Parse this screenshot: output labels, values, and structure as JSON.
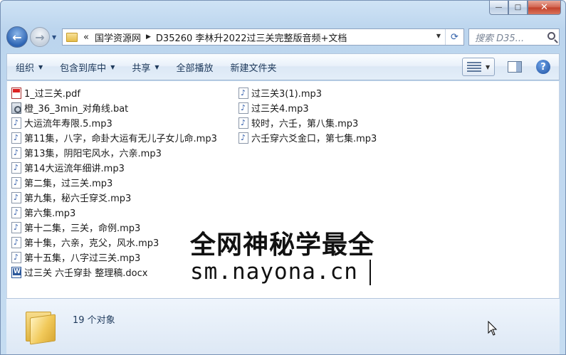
{
  "window": {
    "caption": {
      "minimize": "—",
      "maximize": "□",
      "close": "✕"
    }
  },
  "nav": {
    "back": "←",
    "forward": "→"
  },
  "address": {
    "overflow": "«",
    "parts": [
      "国学资源网",
      "D35260 李林升2022过三关完整版音频+文档"
    ],
    "refresh": "⟳"
  },
  "search": {
    "placeholder": "搜索 D35..."
  },
  "toolbar": {
    "organize": "组织",
    "include_in_library": "包含到库中",
    "share": "共享",
    "play_all": "全部播放",
    "new_folder": "新建文件夹",
    "help": "?"
  },
  "files": {
    "col1": [
      {
        "name": "1_过三关.pdf",
        "type": "pdf"
      },
      {
        "name": "橙_36_3min_对角线.bat",
        "type": "bat"
      },
      {
        "name": "大运流年寿限.5.mp3",
        "type": "mp3"
      },
      {
        "name": "第11集，八字，命卦大运有无儿子女儿命.mp3",
        "type": "mp3"
      },
      {
        "name": "第13集，阴阳宅风水，六亲.mp3",
        "type": "mp3"
      },
      {
        "name": "第14大运流年细讲.mp3",
        "type": "mp3"
      },
      {
        "name": "第二集，过三关.mp3",
        "type": "mp3"
      },
      {
        "name": "第九集，秘六壬穿爻.mp3",
        "type": "mp3"
      },
      {
        "name": "第六集.mp3",
        "type": "mp3"
      },
      {
        "name": "第十二集，三关，命例.mp3",
        "type": "mp3"
      },
      {
        "name": "第十集，六亲，克父，风水.mp3",
        "type": "mp3"
      },
      {
        "name": "第十五集，八字过三关.mp3",
        "type": "mp3"
      },
      {
        "name": "过三关 六壬穿卦 整理稿.docx",
        "type": "docx"
      }
    ],
    "col2": [
      {
        "name": "过三关3(1).mp3",
        "type": "mp3"
      },
      {
        "name": "过三关4.mp3",
        "type": "mp3"
      },
      {
        "name": "较时，六壬，第八集.mp3",
        "type": "mp3"
      },
      {
        "name": "六壬穿六爻金口，第七集.mp3",
        "type": "mp3"
      }
    ]
  },
  "watermark": {
    "title": "全网神秘学最全",
    "url": "sm.nayona.cn"
  },
  "status": {
    "count": "19 个对象"
  }
}
